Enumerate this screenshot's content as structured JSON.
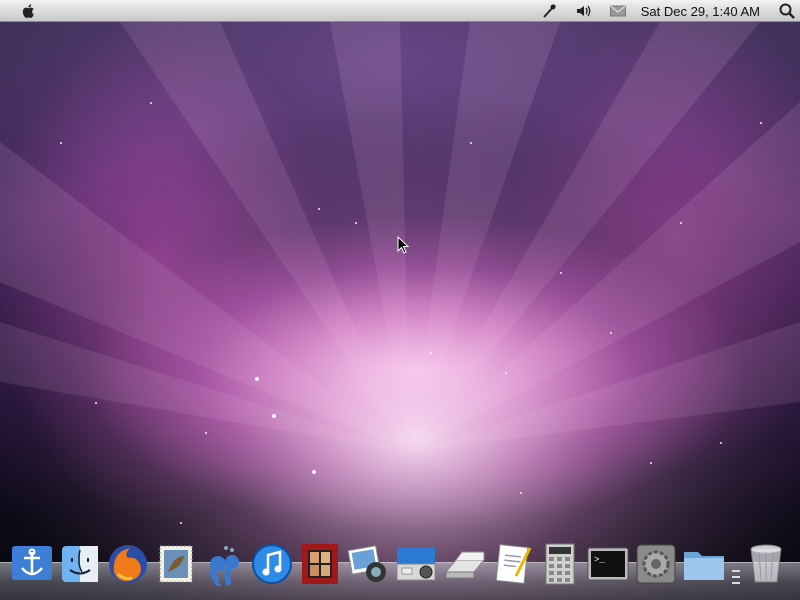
{
  "menubar": {
    "clock": "Sat Dec 29,  1:40 AM",
    "icons": [
      "apple-icon",
      "script-icon",
      "volume-icon",
      "mail-icon",
      "spotlight-icon"
    ]
  },
  "dock": {
    "items": [
      "anchor-icon",
      "finder-icon",
      "firefox-icon",
      "mail-stamp-icon",
      "ichat-icon",
      "itunes-icon",
      "photo-booth-icon",
      "iphoto-icon",
      "camera-icon",
      "scanner-icon",
      "textedit-icon",
      "calculator-icon",
      "terminal-icon",
      "system-preferences-icon",
      "folder-icon",
      "trash-icon"
    ]
  },
  "colors": {
    "accent": "#d46bd0",
    "menubar": "#d9d9d9"
  }
}
